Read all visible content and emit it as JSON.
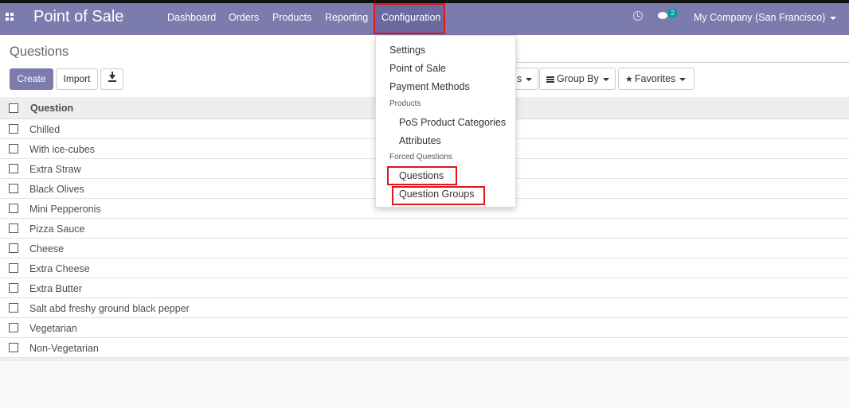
{
  "navbar": {
    "app_title": "Point of Sale",
    "menu": [
      "Dashboard",
      "Orders",
      "Products",
      "Reporting",
      "Configuration"
    ],
    "active_menu": "Configuration",
    "chat_badge": "2",
    "company": "My Company (San Francisco)"
  },
  "control_panel": {
    "breadcrumb": "Questions",
    "create_label": "Create",
    "import_label": "Import",
    "filters_label_visible": "s",
    "group_by_label": "Group By",
    "favorites_label": "Favorites",
    "search_dot": "."
  },
  "list": {
    "column_header": "Question",
    "rows": [
      "Chilled",
      "With ice-cubes",
      "Extra Straw",
      "Black Olives",
      "Mini Pepperonis",
      "Pizza Sauce",
      "Cheese",
      "Extra Cheese",
      "Extra Butter",
      "Salt abd freshy ground black pepper",
      "Vegetarian",
      "Non-Vegetarian"
    ]
  },
  "config_menu": {
    "items": [
      {
        "label": "Settings",
        "kind": "item"
      },
      {
        "label": "Point of Sale",
        "kind": "item"
      },
      {
        "label": "Payment Methods",
        "kind": "item"
      },
      {
        "label": "Products",
        "kind": "header"
      },
      {
        "label": "PoS Product Categories",
        "kind": "subitem"
      },
      {
        "label": "Attributes",
        "kind": "subitem"
      },
      {
        "label": "Forced Questions",
        "kind": "header"
      },
      {
        "label": "Questions",
        "kind": "subitem"
      },
      {
        "label": "Question Groups",
        "kind": "subitem"
      }
    ]
  },
  "colors": {
    "brand": "#7c7bad",
    "highlight": "#e0161b",
    "badge": "#00a09d"
  }
}
